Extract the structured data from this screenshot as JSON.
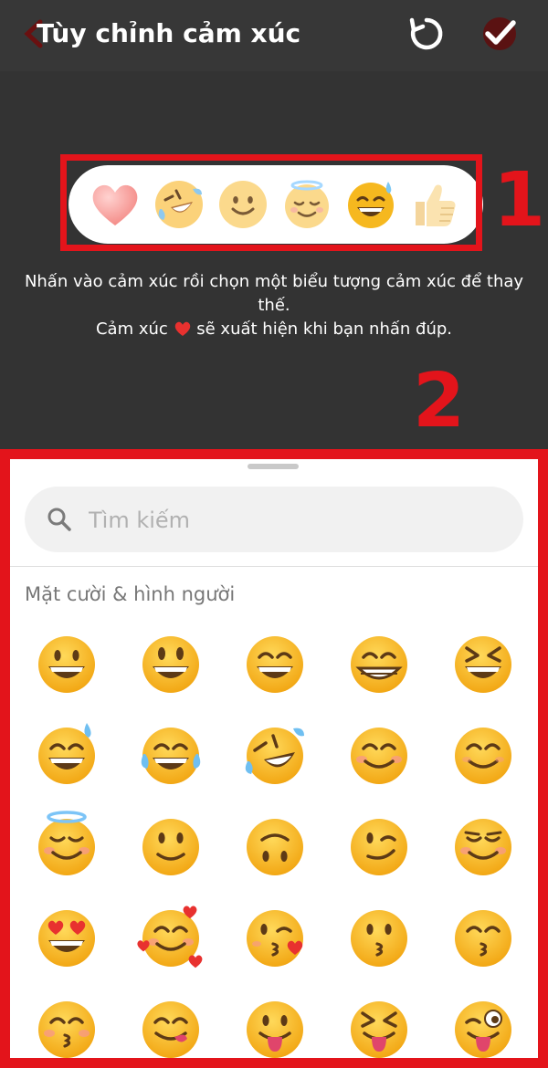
{
  "header": {
    "title": "Tùy chỉnh cảm xúc",
    "back_icon": "back-arrow-icon",
    "reset_icon": "reset-icon",
    "confirm_icon": "checkmark-icon"
  },
  "reactions": [
    {
      "icon": "heart-emoji"
    },
    {
      "icon": "rolling-laughing-emoji"
    },
    {
      "icon": "slightly-smiling-emoji"
    },
    {
      "icon": "halo-smiling-emoji"
    },
    {
      "icon": "grinning-sweat-emoji"
    },
    {
      "icon": "thumbs-up-emoji"
    }
  ],
  "annotations": {
    "label_1": "1",
    "label_2": "2",
    "accent_color": "#e3141b"
  },
  "instructions": {
    "line1": "Nhấn vào cảm xúc rồi chọn một biểu tượng cảm xúc để thay thế.",
    "line2_before": "Cảm xúc",
    "line2_after": "sẽ xuất hiện khi bạn nhấn đúp."
  },
  "picker": {
    "search_placeholder": "Tìm kiếm",
    "section_title": "Mặt cười & hình người",
    "emojis": [
      "grinning",
      "grinning-big-eyes",
      "grinning-smiling-eyes",
      "beaming",
      "squinting-laugh",
      "grinning-sweat",
      "tears-of-joy",
      "rolling-laughing",
      "smiling-blush",
      "smiling-eyes",
      "halo",
      "slightly-smiling",
      "upside-down",
      "winking",
      "relieved",
      "heart-eyes",
      "smiling-hearts",
      "kissing-heart",
      "kissing",
      "kissing-smiling-eyes",
      "kissing-closed-eyes",
      "yum",
      "tongue",
      "squinting-tongue",
      "winking-tongue"
    ]
  }
}
